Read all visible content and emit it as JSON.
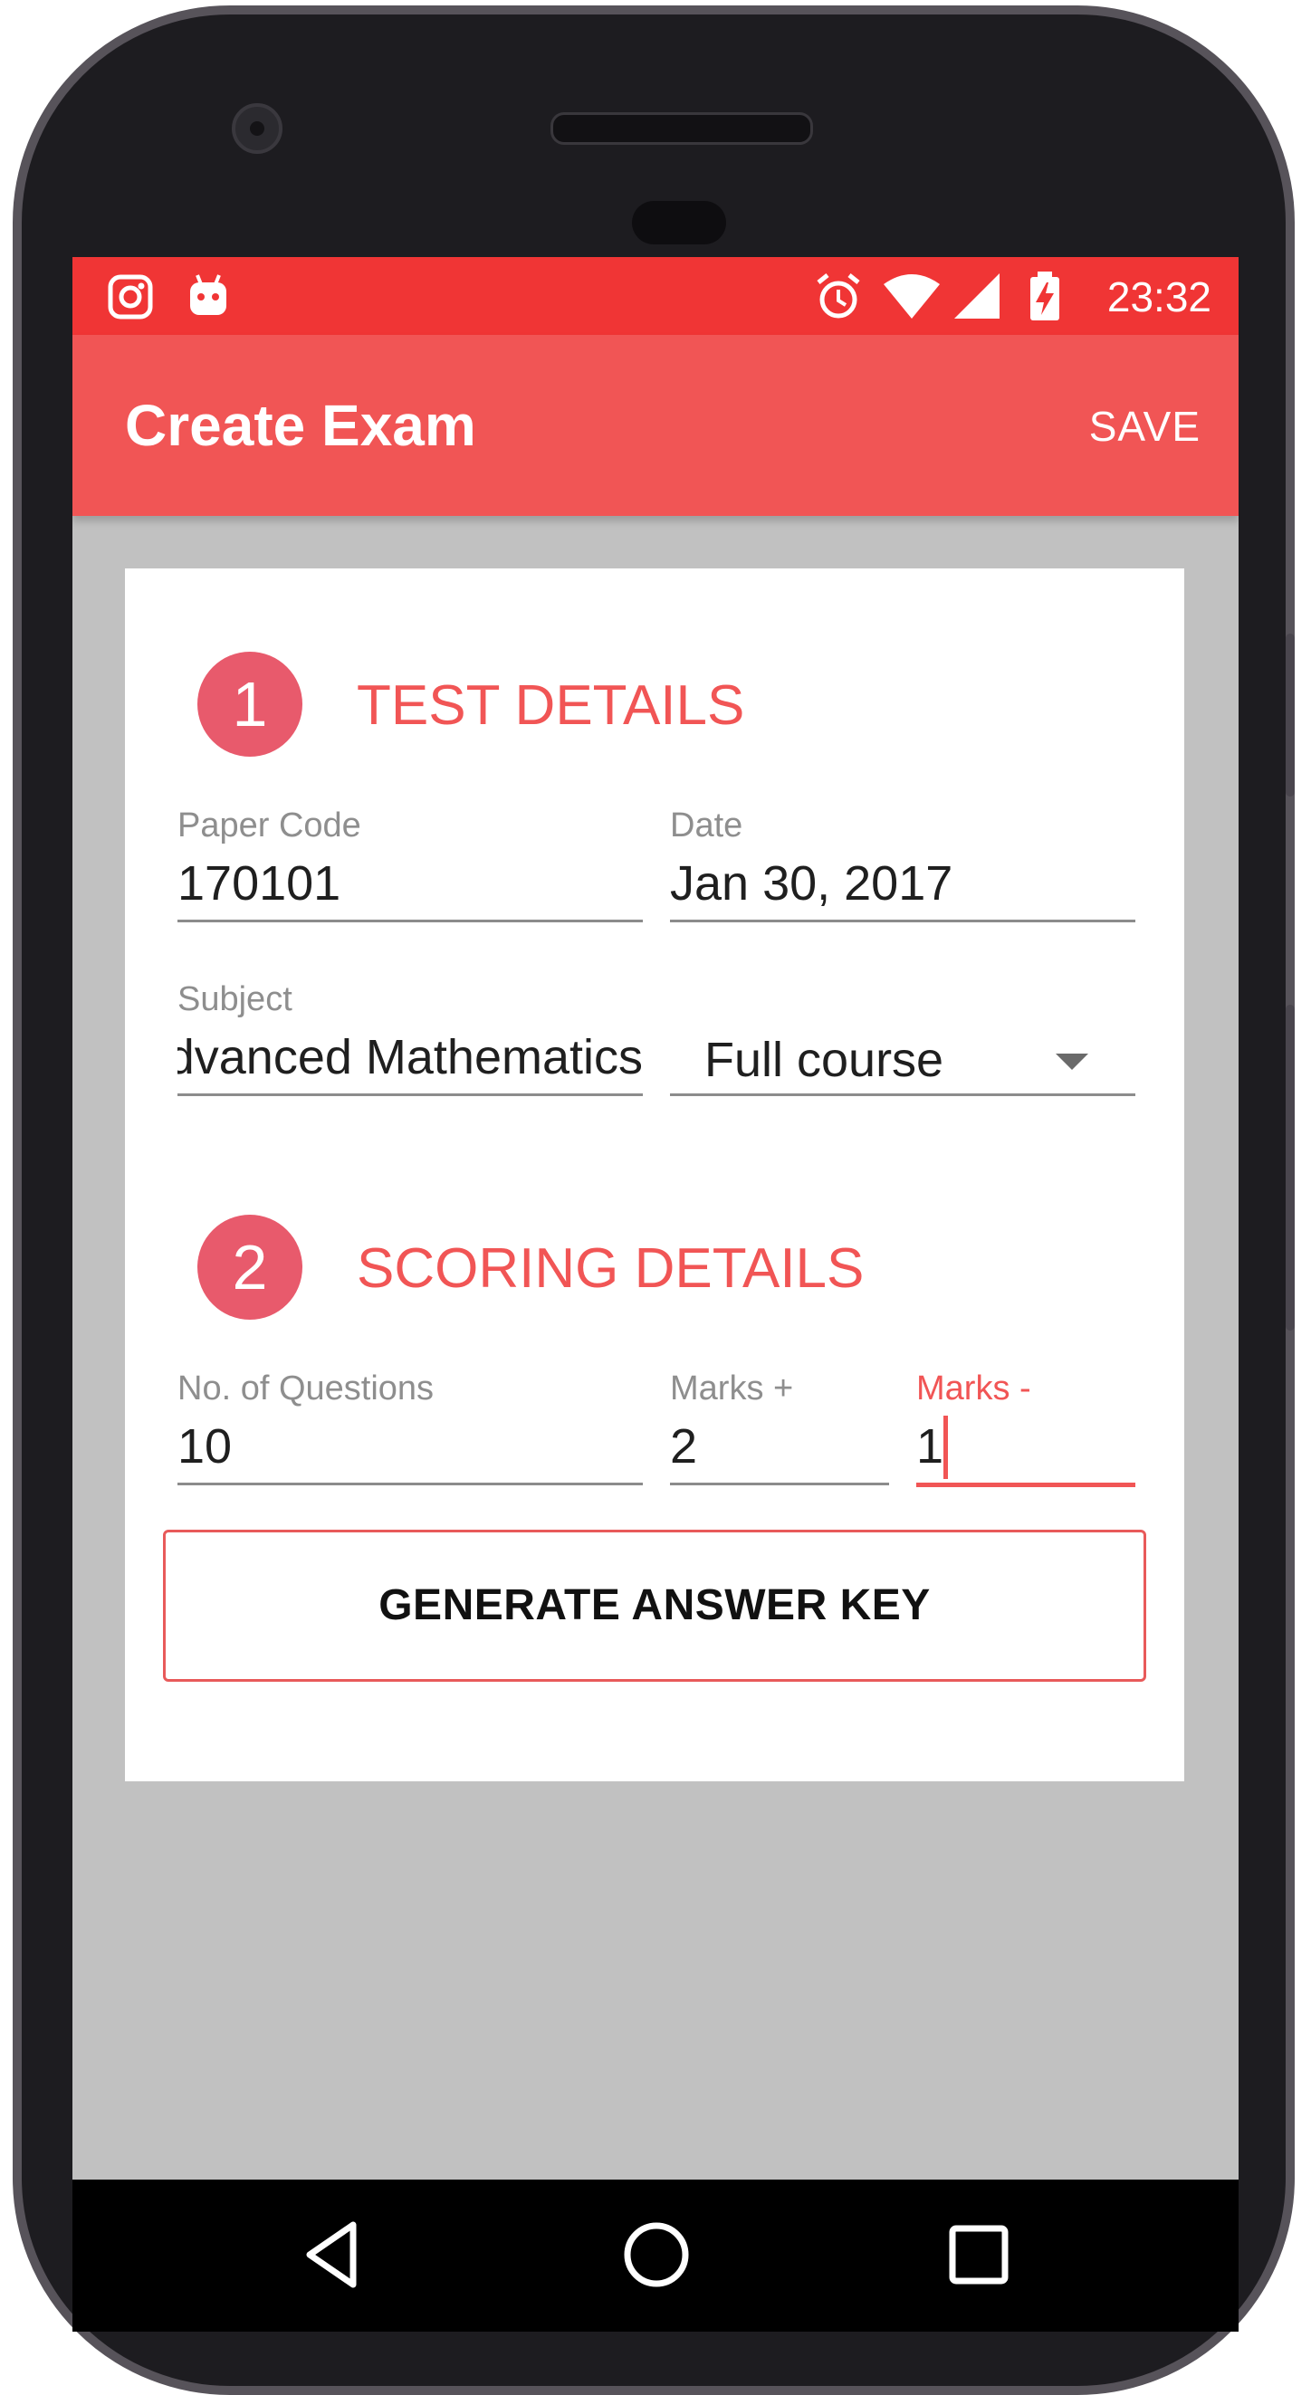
{
  "status_bar": {
    "time": "23:32",
    "left_icons": [
      "instagram-icon",
      "android-bot-icon"
    ],
    "right_icons": [
      "alarm-icon",
      "wifi-icon",
      "signal-icon",
      "battery-charging-icon"
    ]
  },
  "app_bar": {
    "title": "Create Exam",
    "save_label": "SAVE"
  },
  "test_details": {
    "step_number": "1",
    "title": "TEST DETAILS",
    "paper_code": {
      "label": "Paper Code",
      "value": "170101"
    },
    "date": {
      "label": "Date",
      "value": "Jan 30, 2017"
    },
    "subject": {
      "label": "Subject",
      "value": "Advanced Mathematics"
    },
    "scope": {
      "selected": "Full course"
    }
  },
  "scoring_details": {
    "step_number": "2",
    "title": "SCORING DETAILS",
    "questions": {
      "label": "No. of Questions",
      "value": "10"
    },
    "marks_plus": {
      "label": "Marks +",
      "value": "2"
    },
    "marks_minus": {
      "label": "Marks -",
      "value": "1"
    }
  },
  "generate_button_label": "GENERATE ANSWER KEY",
  "nav_bar": {
    "icons": [
      "back-icon",
      "home-icon",
      "recents-icon"
    ]
  },
  "colors": {
    "status_bar": "#f03535",
    "app_bar": "#f15555",
    "accent": "#f15555",
    "step_circle": "#e85a6c",
    "background": "#c1c1c1"
  }
}
